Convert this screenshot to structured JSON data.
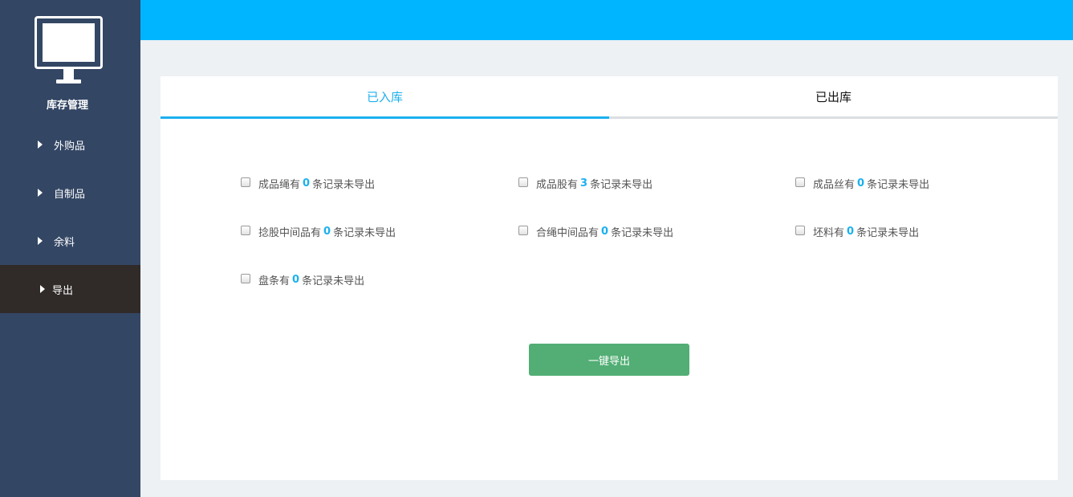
{
  "sidebar": {
    "title": "库存管理",
    "items": [
      {
        "label": "外购品"
      },
      {
        "label": "自制品"
      },
      {
        "label": "余料"
      },
      {
        "label": "导出"
      }
    ],
    "active_item": "导出"
  },
  "tabs": [
    {
      "label": "已入库"
    },
    {
      "label": "已出库"
    }
  ],
  "active_tab": "已入库",
  "records": [
    {
      "name": "成品绳有",
      "count": "0",
      "suffix": "条记录未导出",
      "checked": false
    },
    {
      "name": "成品股有",
      "count": "3",
      "suffix": "条记录未导出",
      "checked": false
    },
    {
      "name": "成品丝有",
      "count": "0",
      "suffix": "条记录未导出",
      "checked": false
    },
    {
      "name": "捻股中间品有",
      "count": "0",
      "suffix": "条记录未导出",
      "checked": false
    },
    {
      "name": "合绳中间品有",
      "count": "0",
      "suffix": "条记录未导出",
      "checked": false
    },
    {
      "name": "坯料有",
      "count": "0",
      "suffix": "条记录未导出",
      "checked": false
    },
    {
      "name": "盘条有",
      "count": "0",
      "suffix": "条记录未导出",
      "checked": false
    }
  ],
  "export_button": "一键导出",
  "colors": {
    "sidebar_bg": "#334664",
    "active_nav_bg": "#302b29",
    "topbar": "#00b5ff",
    "accent": "#1cb0ee",
    "button": "#52ae74"
  }
}
